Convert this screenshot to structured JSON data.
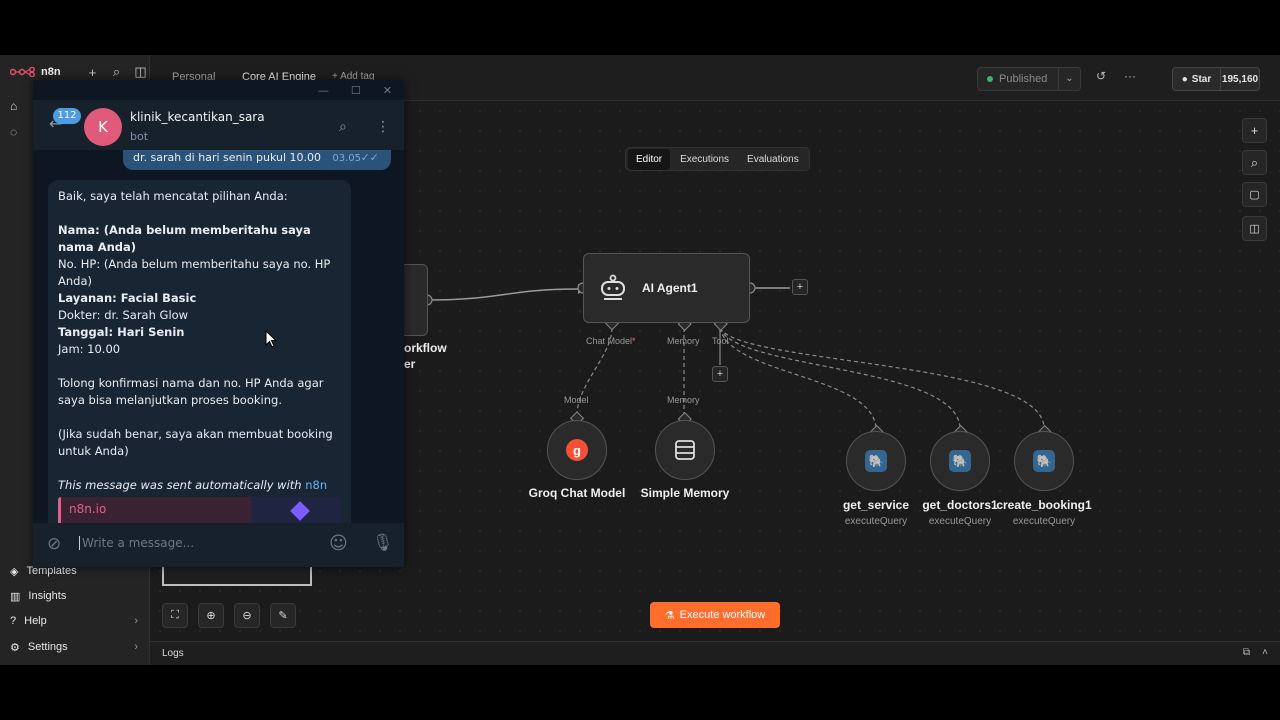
{
  "app": {
    "brand": "n8n",
    "breadcrumb": {
      "project": "Personal",
      "workflow_name": "Core AI Engine",
      "add_tag": "+ Add tag"
    },
    "published_label": "Published",
    "github": {
      "star_label": "Star",
      "star_count": "195,160"
    }
  },
  "sidebar": {
    "bottom_items": [
      {
        "label": "Templates",
        "icon": "template-icon"
      },
      {
        "label": "Insights",
        "icon": "chart-icon"
      },
      {
        "label": "Help",
        "icon": "help-icon"
      },
      {
        "label": "Settings",
        "icon": "gear-icon"
      }
    ]
  },
  "tabs": [
    {
      "label": "Editor",
      "active": true
    },
    {
      "label": "Executions",
      "active": false
    },
    {
      "label": "Evaluations",
      "active": false
    }
  ],
  "canvas": {
    "agent": {
      "title": "AI Agent1",
      "ports": {
        "chat_model": "Chat Model",
        "memory": "Memory",
        "tool": "Tool"
      }
    },
    "trigger_partial": {
      "line1": "orkflow",
      "line2": "er"
    },
    "subnodes": [
      {
        "label": "Groq Chat Model",
        "port": "Model"
      },
      {
        "label": "Simple Memory",
        "port": "Memory"
      }
    ],
    "tools": [
      {
        "label": "get_service",
        "sub": "executeQuery"
      },
      {
        "label": "get_doctors1",
        "sub": "executeQuery"
      },
      {
        "label": "create_booking1",
        "sub": "executeQuery"
      }
    ],
    "execute_label": "Execute workflow",
    "logs_label": "Logs"
  },
  "telegram": {
    "unread_count": "112",
    "avatar_letter": "K",
    "chat_name": "klinik_kecantikan_sara",
    "chat_status": "bot",
    "outgoing": {
      "text": "dr. sarah di hari senin pukul 10.00",
      "time": "03.05"
    },
    "incoming": {
      "line1": "Baik, saya telah mencatat pilihan Anda:",
      "nama": " Nama: (Anda belum memberitahu saya nama Anda)",
      "hp": " No. HP: (Anda belum memberitahu saya no. HP Anda)",
      "layanan": " Layanan: Facial Basic",
      "dokter": " Dokter: dr. Sarah Glow",
      "tanggal": " Tanggal: Hari Senin",
      "jam": " Jam: 10.00",
      "konfirmasi": "Tolong konfirmasi nama dan no. HP Anda agar saya bisa melanjutkan proses booking.",
      "jika": "(Jika sudah benar, saya akan membuat booking untuk Anda)",
      "auto_prefix": "This message was sent automatically with ",
      "auto_link": "n8n",
      "preview_site": "n8n.io"
    },
    "input_placeholder": "Write a message..."
  }
}
